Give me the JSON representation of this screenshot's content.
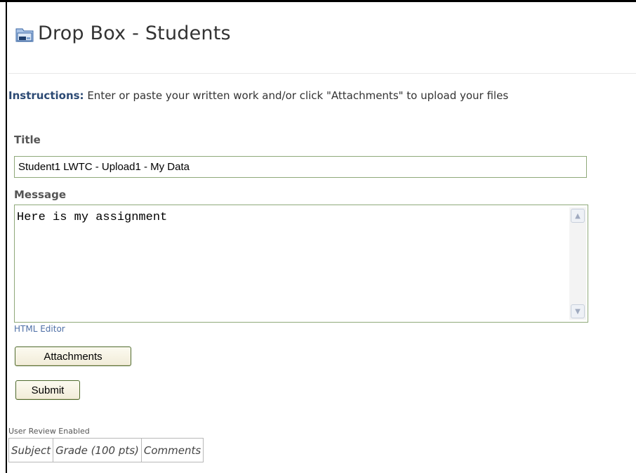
{
  "header": {
    "title": "Drop Box - Students",
    "icon": "dropbox-folder-icon"
  },
  "instructions": {
    "label": "Instructions:",
    "text": " Enter or paste your written work and/or click \"Attachments\" to upload your files"
  },
  "form": {
    "title_label": "Title",
    "title_value": "Student1 LWTC - Upload1 - My Data",
    "message_label": "Message",
    "message_value": "Here is my assignment",
    "html_editor_link": "HTML Editor",
    "attachments_button": "Attachments",
    "submit_button": "Submit"
  },
  "review": {
    "note": "User Review Enabled",
    "columns": [
      "Subject",
      "Grade (100 pts)",
      "Comments"
    ]
  },
  "colors": {
    "field_border": "#8fa97a",
    "button_border": "#4f6a2d",
    "link": "#4e6fa6"
  }
}
